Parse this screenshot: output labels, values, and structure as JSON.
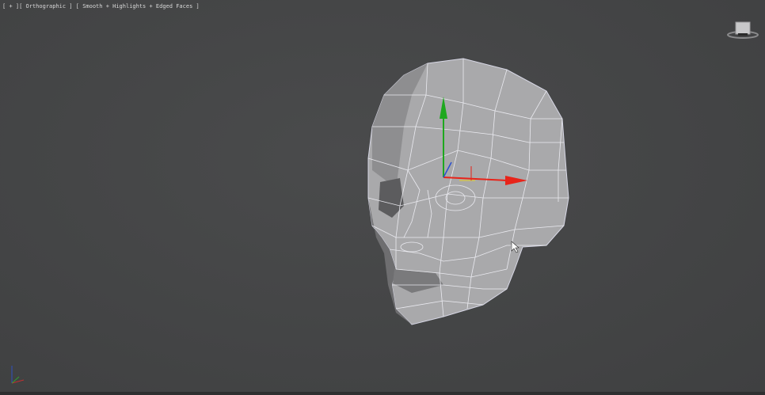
{
  "viewport": {
    "label": {
      "open": "[",
      "plus_menu": "+",
      "view_menu": "Orthographic",
      "shading_menu": "Smooth + Highlights + Edged Faces",
      "close": "]",
      "sep": "][",
      "sep2": "] ["
    },
    "gizmo_colors": {
      "x": "#e8241a",
      "y": "#1ea81e",
      "z": "#2a4fd0"
    },
    "mesh_color": "#a9a9ab",
    "wire_color": "#ffffff"
  }
}
